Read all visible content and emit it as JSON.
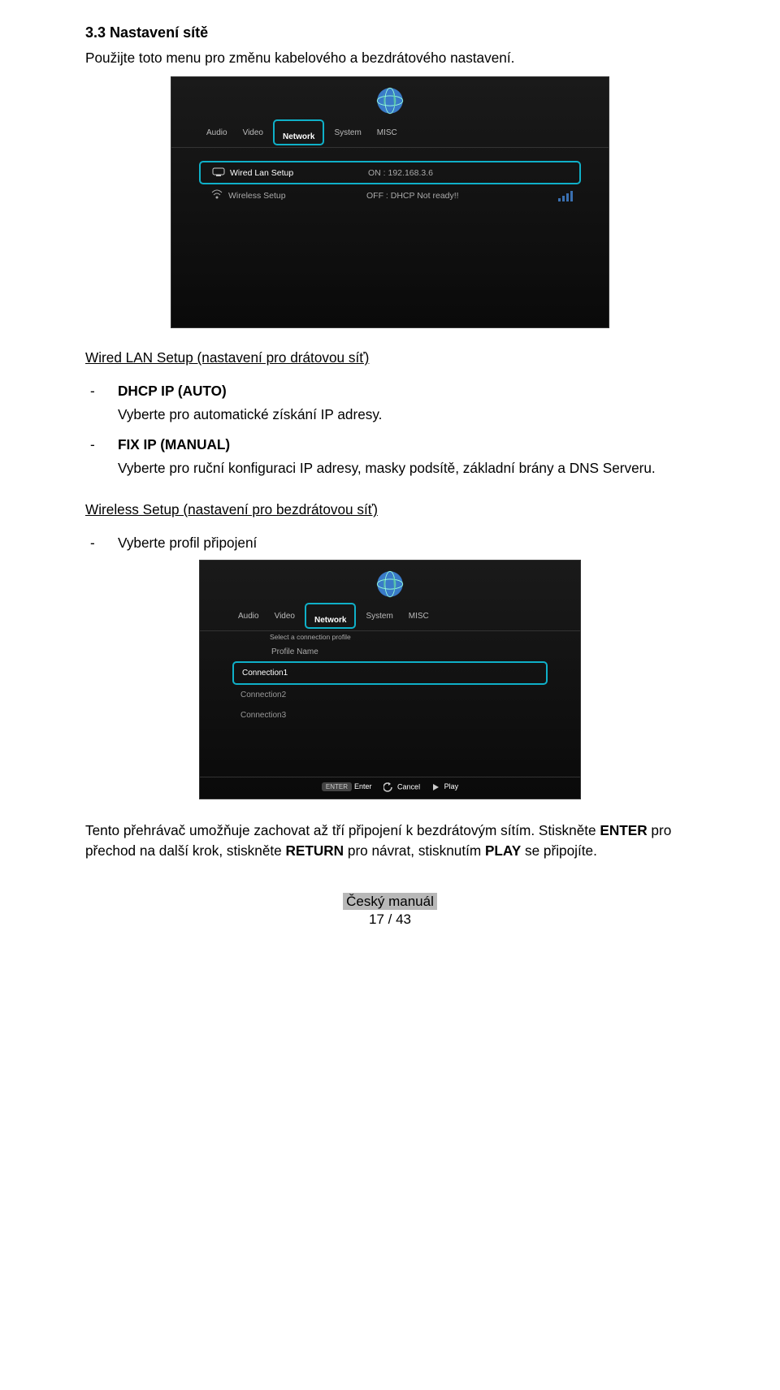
{
  "section": {
    "title": "3.3 Nastavení sítě",
    "intro": "Použijte toto menu pro změnu kabelového a bezdrátového nastavení."
  },
  "screenshot1": {
    "tabs": [
      "Audio",
      "Video",
      "Network",
      "System",
      "MISC"
    ],
    "active_tab": "Network",
    "rows": {
      "wired": {
        "label": "Wired Lan Setup",
        "value": "ON : 192.168.3.6"
      },
      "wireless": {
        "label": "Wireless Setup",
        "value": "OFF : DHCP Not ready!!"
      }
    }
  },
  "wired": {
    "heading": "Wired LAN Setup (nastavení pro drátovou síť)",
    "items": [
      {
        "title": "DHCP IP (AUTO)",
        "text": "Vyberte pro automatické získání IP adresy."
      },
      {
        "title": "FIX IP (MANUAL)",
        "text": "Vyberte pro ruční konfiguraci IP adresy, masky podsítě, základní brány a DNS Serveru."
      }
    ]
  },
  "wireless": {
    "heading": "Wireless Setup (nastavení pro bezdrátovou síť)",
    "bullet": "Vyberte profil připojení"
  },
  "screenshot2": {
    "tabs": [
      "Audio",
      "Video",
      "Network",
      "System",
      "MISC"
    ],
    "active_tab": "Network",
    "subtitle": "Select a connection profile",
    "profile_label": "Profile Name",
    "profiles": [
      "Connection1",
      "Connection2",
      "Connection3"
    ],
    "footer": {
      "enter_key": "ENTER",
      "enter": "Enter",
      "cancel": "Cancel",
      "play": "Play"
    }
  },
  "closing": {
    "text_parts": {
      "p1": "Tento přehrávač umožňuje zachovat až tří připojení k bezdrátovým sítím. Stiskněte ",
      "enter": "ENTER",
      "p2": " pro přechod na další krok, stiskněte ",
      "return": "RETURN",
      "p3": "  pro návrat, stisknutím ",
      "play": "PLAY",
      "p4": " se připojíte."
    }
  },
  "footer": {
    "manual": "Český manuál",
    "page": "17 / 43"
  }
}
